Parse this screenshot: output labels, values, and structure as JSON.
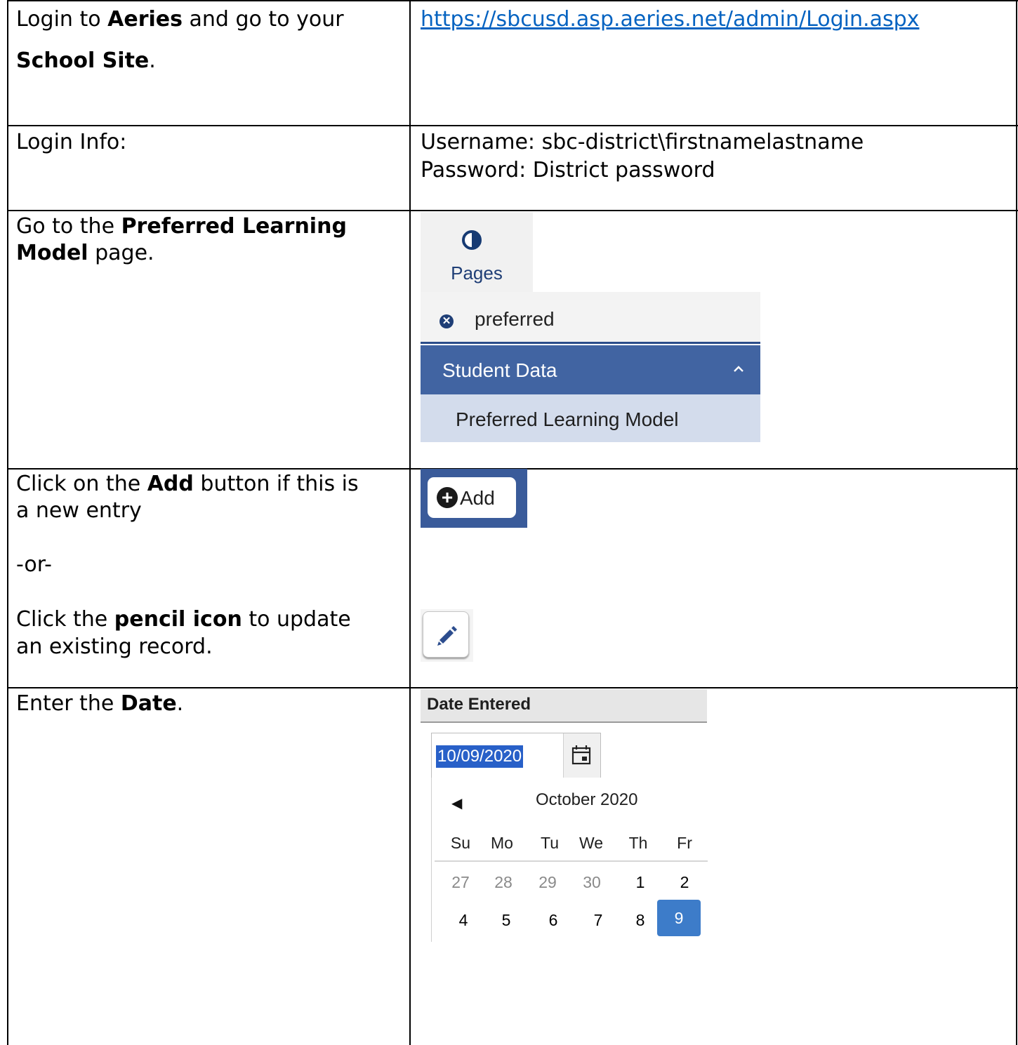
{
  "rows": [
    {
      "instruction": {
        "pre": "Login to ",
        "bold1": "Aeries",
        "mid": " and go to your",
        "bold2": "School Site",
        "post": "."
      },
      "link": "https://sbcusd.asp.aeries.net/admin/Login.aspx"
    },
    {
      "instruction": "Login Info:",
      "username_line": "Username: sbc-district\\firstnamelastname",
      "password_line": "Password: District password"
    },
    {
      "instruction": {
        "pre": "Go to the ",
        "bold1": "Preferred Learning",
        "bold2": "Model",
        "post": " page."
      },
      "widget": {
        "tab_label": "Pages",
        "search_text": "preferred",
        "group_label": "Student Data",
        "page_item": "Preferred Learning Model"
      }
    },
    {
      "instruction": {
        "line1_pre": "Click on the ",
        "line1_bold": "Add",
        "line1_post": " button if this is",
        "line2": "a new entry",
        "or": "-or-",
        "line3_pre": "Click the ",
        "line3_bold": "pencil icon",
        "line3_post": " to update",
        "line4": "an existing record."
      },
      "add_button_label": "Add"
    },
    {
      "instruction": {
        "pre": "Enter the ",
        "bold": "Date",
        "post": "."
      },
      "date_widget": {
        "header": "Date Entered",
        "value": "10/09/2020",
        "month_label": "October 2020",
        "prev_symbol": "◀",
        "weekdays": [
          "Su",
          "Mo",
          "Tu",
          "We",
          "Th",
          "Fr"
        ],
        "week1": [
          "27",
          "28",
          "29",
          "30",
          "1",
          "2"
        ],
        "week2": [
          "4",
          "5",
          "6",
          "7",
          "8",
          "9"
        ],
        "selected_day": "9"
      }
    }
  ],
  "colors": {
    "link": "#0563c1",
    "navy": "#1f3e76",
    "group_bar": "#4164a2",
    "selected_day": "#3d7cc9"
  }
}
